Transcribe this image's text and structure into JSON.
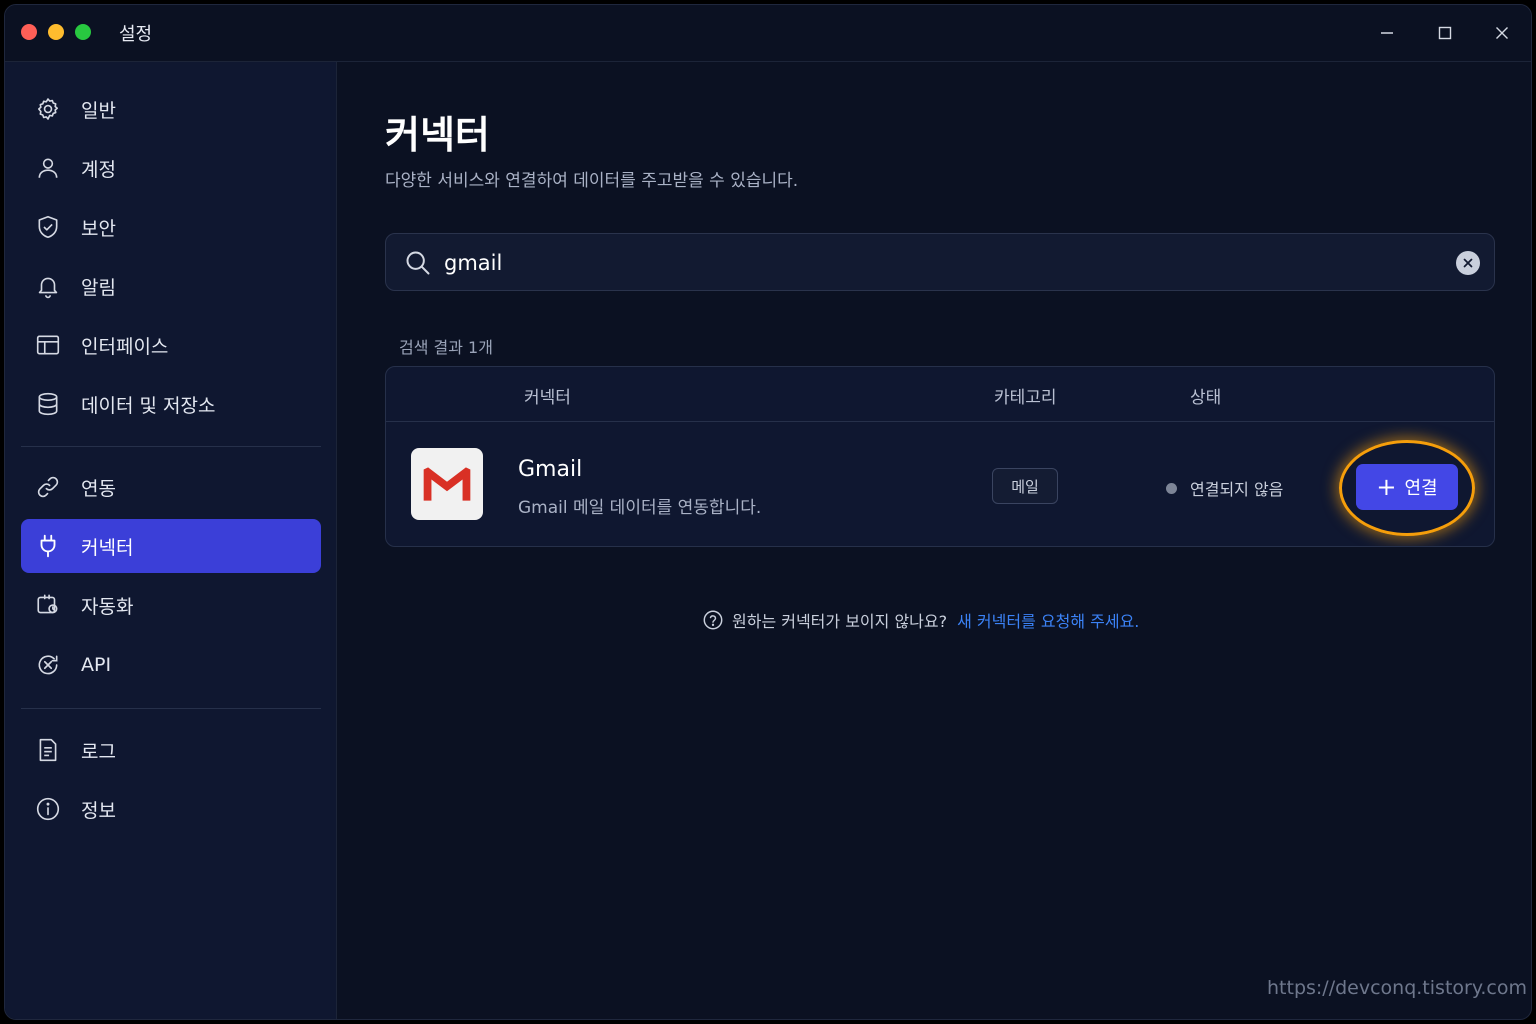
{
  "window": {
    "title": "설정"
  },
  "sidebar": {
    "items": [
      {
        "label": "일반",
        "icon": "gear-icon"
      },
      {
        "label": "계정",
        "icon": "user-icon"
      },
      {
        "label": "보안",
        "icon": "shield-check-icon"
      },
      {
        "label": "알림",
        "icon": "bell-icon"
      },
      {
        "label": "인터페이스",
        "icon": "layout-icon"
      },
      {
        "label": "데이터 및 저장소",
        "icon": "database-icon"
      },
      {
        "label": "연동",
        "icon": "link-icon"
      },
      {
        "label": "커넥터",
        "icon": "plug-icon",
        "active": true
      },
      {
        "label": "자동화",
        "icon": "automation-icon"
      },
      {
        "label": "API",
        "icon": "api-icon"
      },
      {
        "label": "로그",
        "icon": "document-icon"
      },
      {
        "label": "정보",
        "icon": "info-icon"
      }
    ]
  },
  "main": {
    "title": "커넥터",
    "subtitle": "다양한 서비스와 연결하여 데이터를 주고받을 수 있습니다.",
    "search": {
      "value": "gmail",
      "placeholder": ""
    },
    "result_count": "검색 결과 1개",
    "table": {
      "headers": {
        "connector": "커넥터",
        "category": "카테고리",
        "status": "상태"
      },
      "rows": [
        {
          "name": "Gmail",
          "description": "Gmail 메일 데이터를 연동합니다.",
          "category": "메일",
          "status": "연결되지 않음",
          "action": "연결"
        }
      ]
    },
    "help": {
      "question": "원하는 커넥터가 보이지 않나요?",
      "link": "새 커넥터를 요청해 주세요."
    }
  },
  "watermark": "https://devconq.tistory.com",
  "colors": {
    "accent": "#3b3fd8",
    "button": "#4347e6",
    "highlight": "#f59e0b",
    "link": "#3b82f6"
  }
}
